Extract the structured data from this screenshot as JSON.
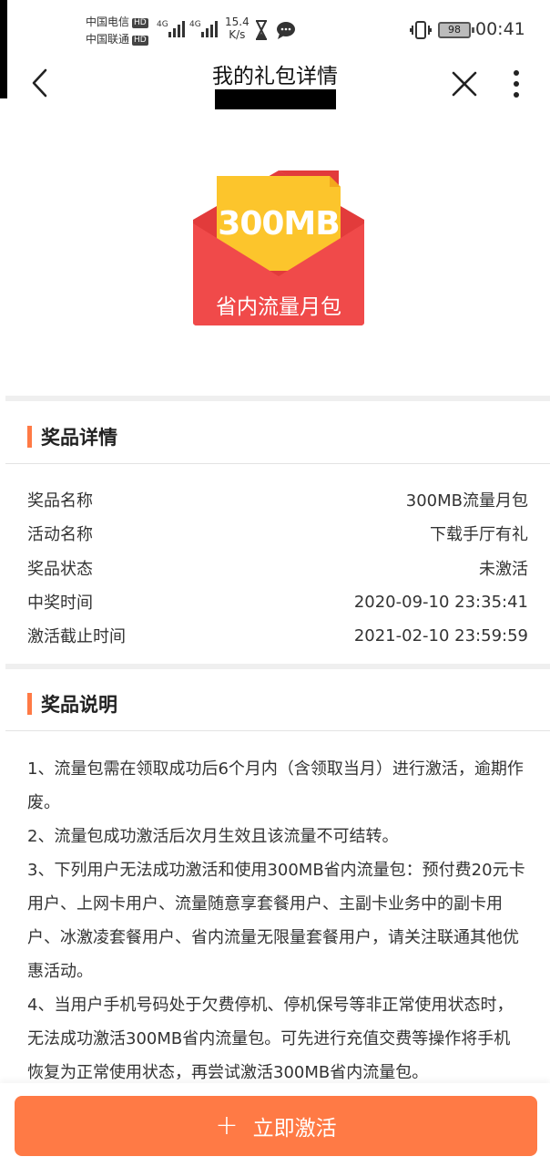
{
  "status_bar": {
    "carrier_1": "中国电信",
    "carrier_2": "中国联通",
    "hd_badge": "HD",
    "network_type": "4G",
    "speed_value": "15.4",
    "speed_unit": "K/s",
    "battery": "98",
    "time": "00:41"
  },
  "nav": {
    "title": "我的礼包详情"
  },
  "envelope": {
    "amount": "300MB",
    "label": "省内流量月包",
    "colors": {
      "red": "#f04a4a",
      "yellow": "#fcc52c"
    }
  },
  "prize_details": {
    "section_title": "奖品详情",
    "rows": [
      {
        "label": "奖品名称",
        "value": "300MB流量月包"
      },
      {
        "label": "活动名称",
        "value": "下载手厅有礼"
      },
      {
        "label": "奖品状态",
        "value": "未激活"
      },
      {
        "label": "中奖时间",
        "value": "2020-09-10 23:35:41"
      },
      {
        "label": "激活截止时间",
        "value": "2021-02-10 23:59:59"
      }
    ]
  },
  "prize_notes": {
    "section_title": "奖品说明",
    "items": [
      "1、流量包需在领取成功后6个月内（含领取当月）进行激活，逾期作废。",
      "2、流量包成功激活后次月生效且该流量不可结转。",
      "3、下列用户无法成功激活和使用300MB省内流量包：预付费20元卡用户、上网卡用户、流量随意享套餐用户、主副卡业务中的副卡用户、冰激凌套餐用户、省内流量无限量套餐用户，请关注联通其他优惠活动。",
      "4、当用户手机号码处于欠费停机、停机保号等非正常使用状态时，无法成功激活300MB省内流量包。可先进行充值交费等操作将手机恢复为正常使用状态，再尝试激活300MB省内流量包。"
    ]
  },
  "action": {
    "activate_label": "立即激活",
    "accent": "#ff7a45"
  }
}
